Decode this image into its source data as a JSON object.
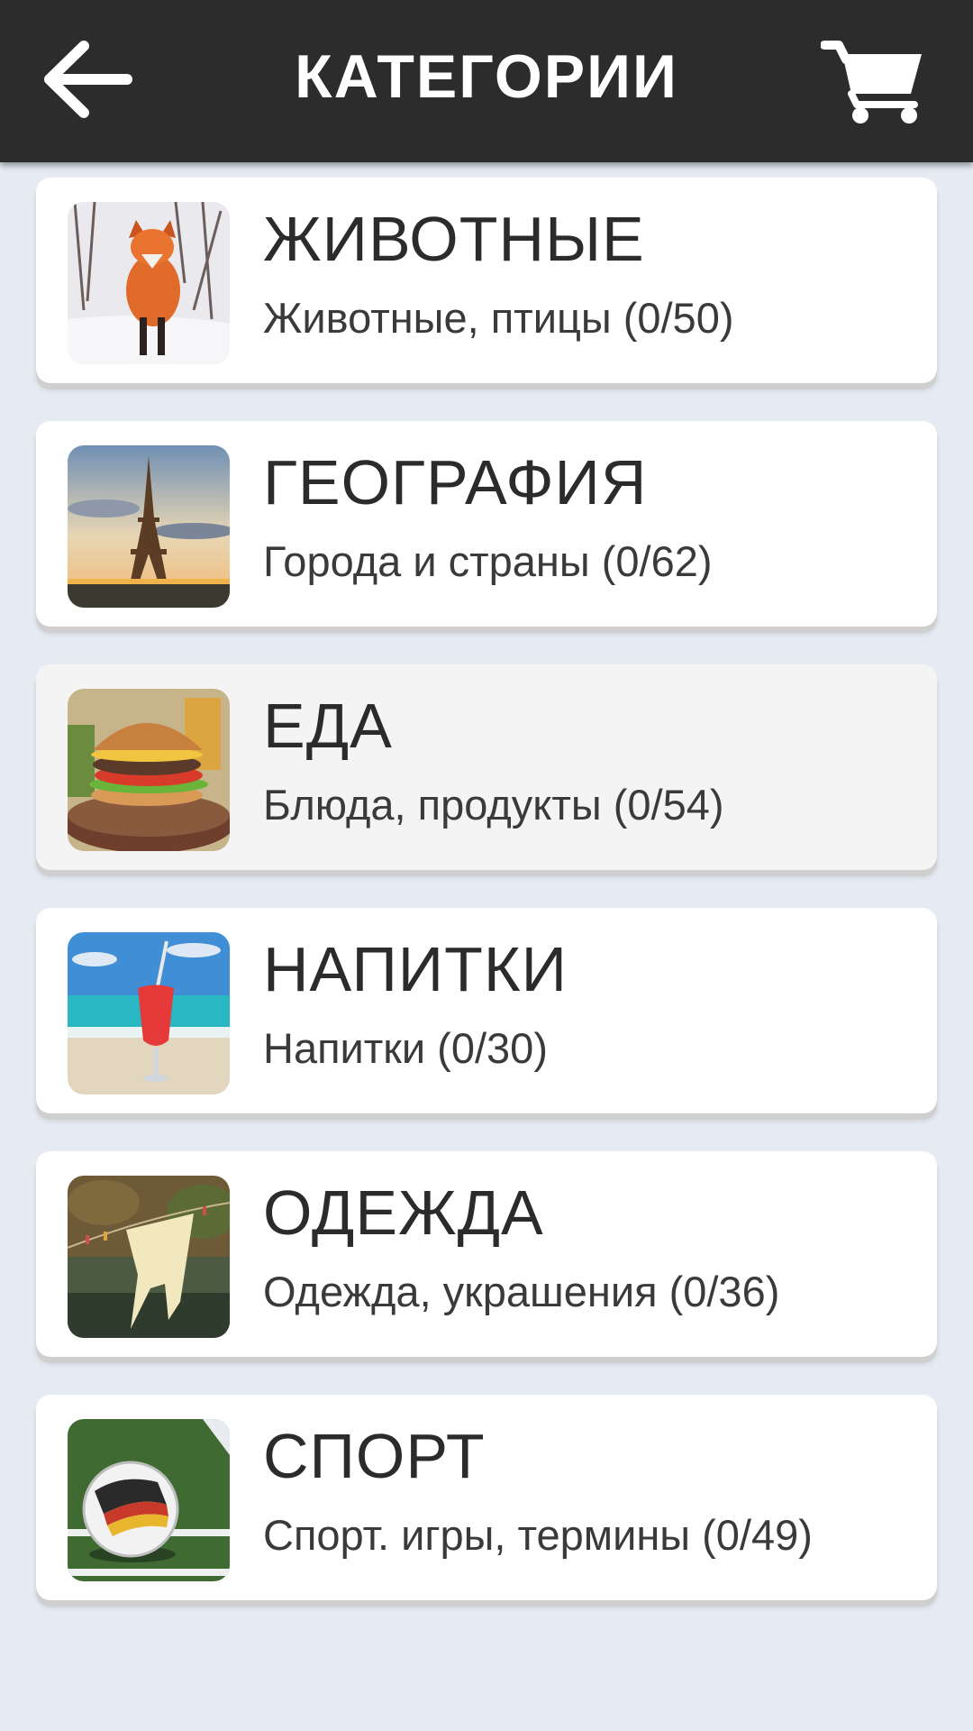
{
  "header": {
    "title": "КАТЕГОРИИ",
    "back_icon": "arrow-left-icon",
    "cart_icon": "cart-icon",
    "background": "#2c2c2c"
  },
  "categories": [
    {
      "title": "ЖИВОТНЫЕ",
      "subtitle": "Животные, птицы (0/50)",
      "image": "fox-image"
    },
    {
      "title": "ГЕОГРАФИЯ",
      "subtitle": "Города и страны (0/62)",
      "image": "eiffel-tower-image"
    },
    {
      "title": "ЕДА",
      "subtitle": "Блюда, продукты (0/54)",
      "image": "burger-image"
    },
    {
      "title": "НАПИТКИ",
      "subtitle": "Напитки (0/30)",
      "image": "cocktail-beach-image"
    },
    {
      "title": "ОДЕЖДА",
      "subtitle": "Одежда, украшения (0/36)",
      "image": "clothesline-image"
    },
    {
      "title": "СПОРТ",
      "subtitle": "Спорт. игры, термины (0/49)",
      "image": "soccer-ball-image"
    }
  ],
  "colors": {
    "page_background": "#e6eaf3",
    "card_background": "#ffffff",
    "card_pressed": "#f4f4f4"
  }
}
